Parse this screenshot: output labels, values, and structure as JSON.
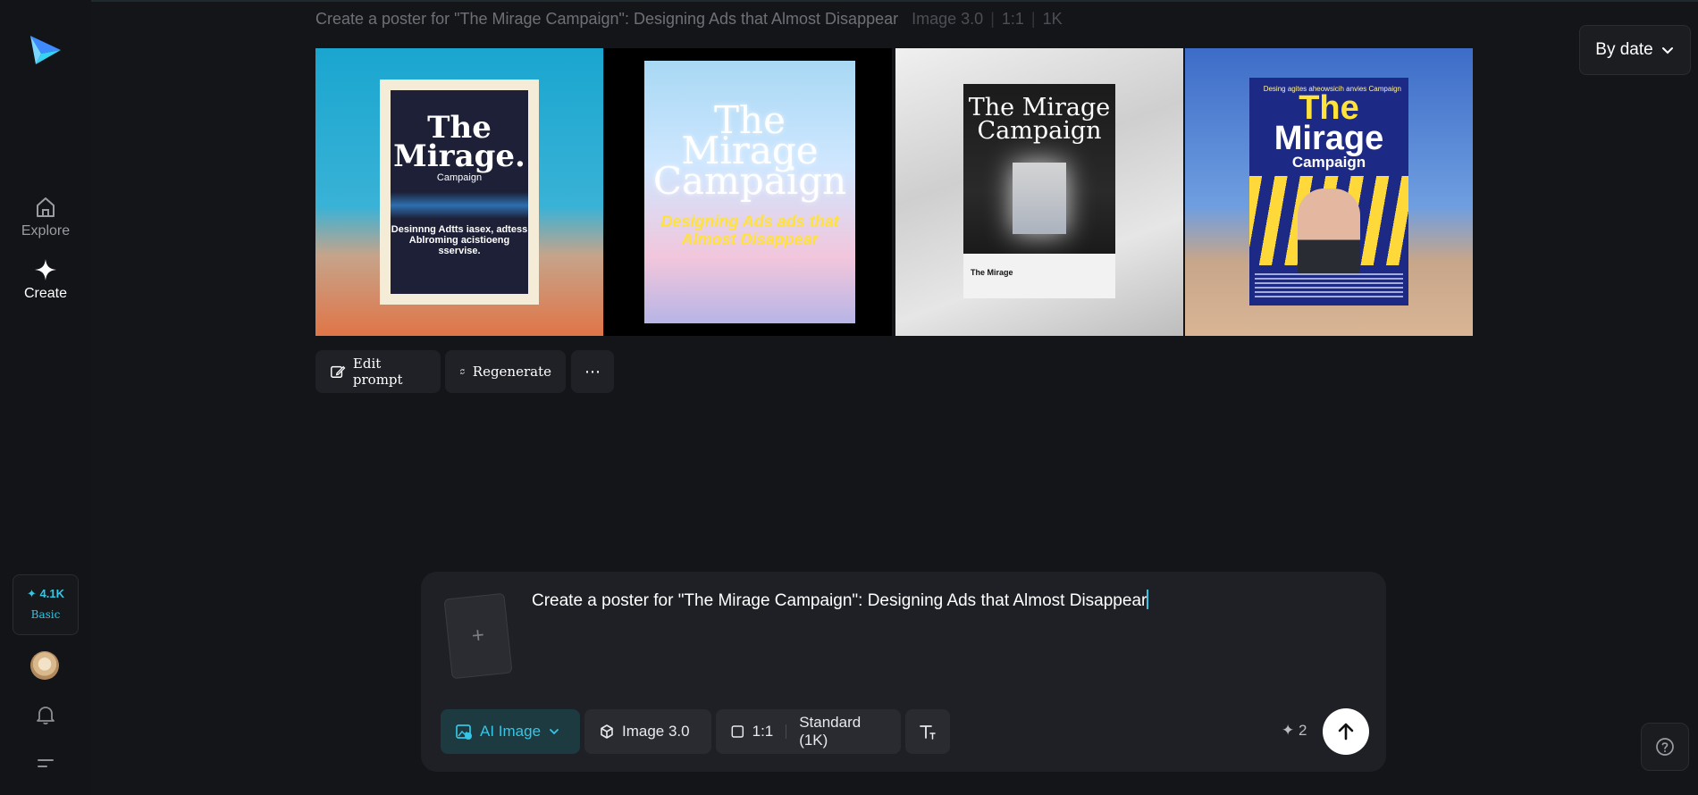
{
  "header": {
    "prompt_text": "Create a poster for \"The Mirage Campaign\": Designing Ads that Almost Disappear",
    "model": "Image 3.0",
    "ratio": "1:1",
    "resolution": "1K",
    "sort_label": "By date"
  },
  "sidebar": {
    "logo_icon": "paper-plane-logo",
    "items": [
      {
        "label": "Explore",
        "icon": "home-icon"
      },
      {
        "label": "Create",
        "icon": "sparkle-icon"
      }
    ],
    "credits": {
      "amount": "✦ 4.1K",
      "plan": "Basic"
    },
    "bell_icon": "bell-icon",
    "menu_icon": "menu-icon"
  },
  "images": [
    {
      "title": "The Mirage.",
      "subtitle": "Campaign",
      "body": "Desinnng Adtts iasex, adtess Ablroming acistioeng sservise."
    },
    {
      "title": "The Mirage Campaign",
      "tagline": "Designing Ads ads that Almost Disappear"
    },
    {
      "title": "The Mirage Campaign",
      "footer": "The Mirage"
    },
    {
      "tag": "Desing agites aheowsicih anvies Campaign",
      "title_line1": "The",
      "title_line2": "Mirage",
      "subtitle": "Campaign"
    }
  ],
  "actions": {
    "edit_prompt": "Edit prompt",
    "regenerate": "Regenerate",
    "more": "⋯"
  },
  "composer": {
    "input_value": "Create a poster for \"The Mirage Campaign\": Designing Ads that Almost Disappear",
    "upload_symbol": "+",
    "mode": "AI Image",
    "model": "Image 3.0",
    "ratio": "1:1",
    "quality": "Standard (1K)",
    "cost": "✦ 2"
  },
  "colors": {
    "accent": "#33c6e6",
    "background": "#141518",
    "panel": "#1f2025"
  }
}
